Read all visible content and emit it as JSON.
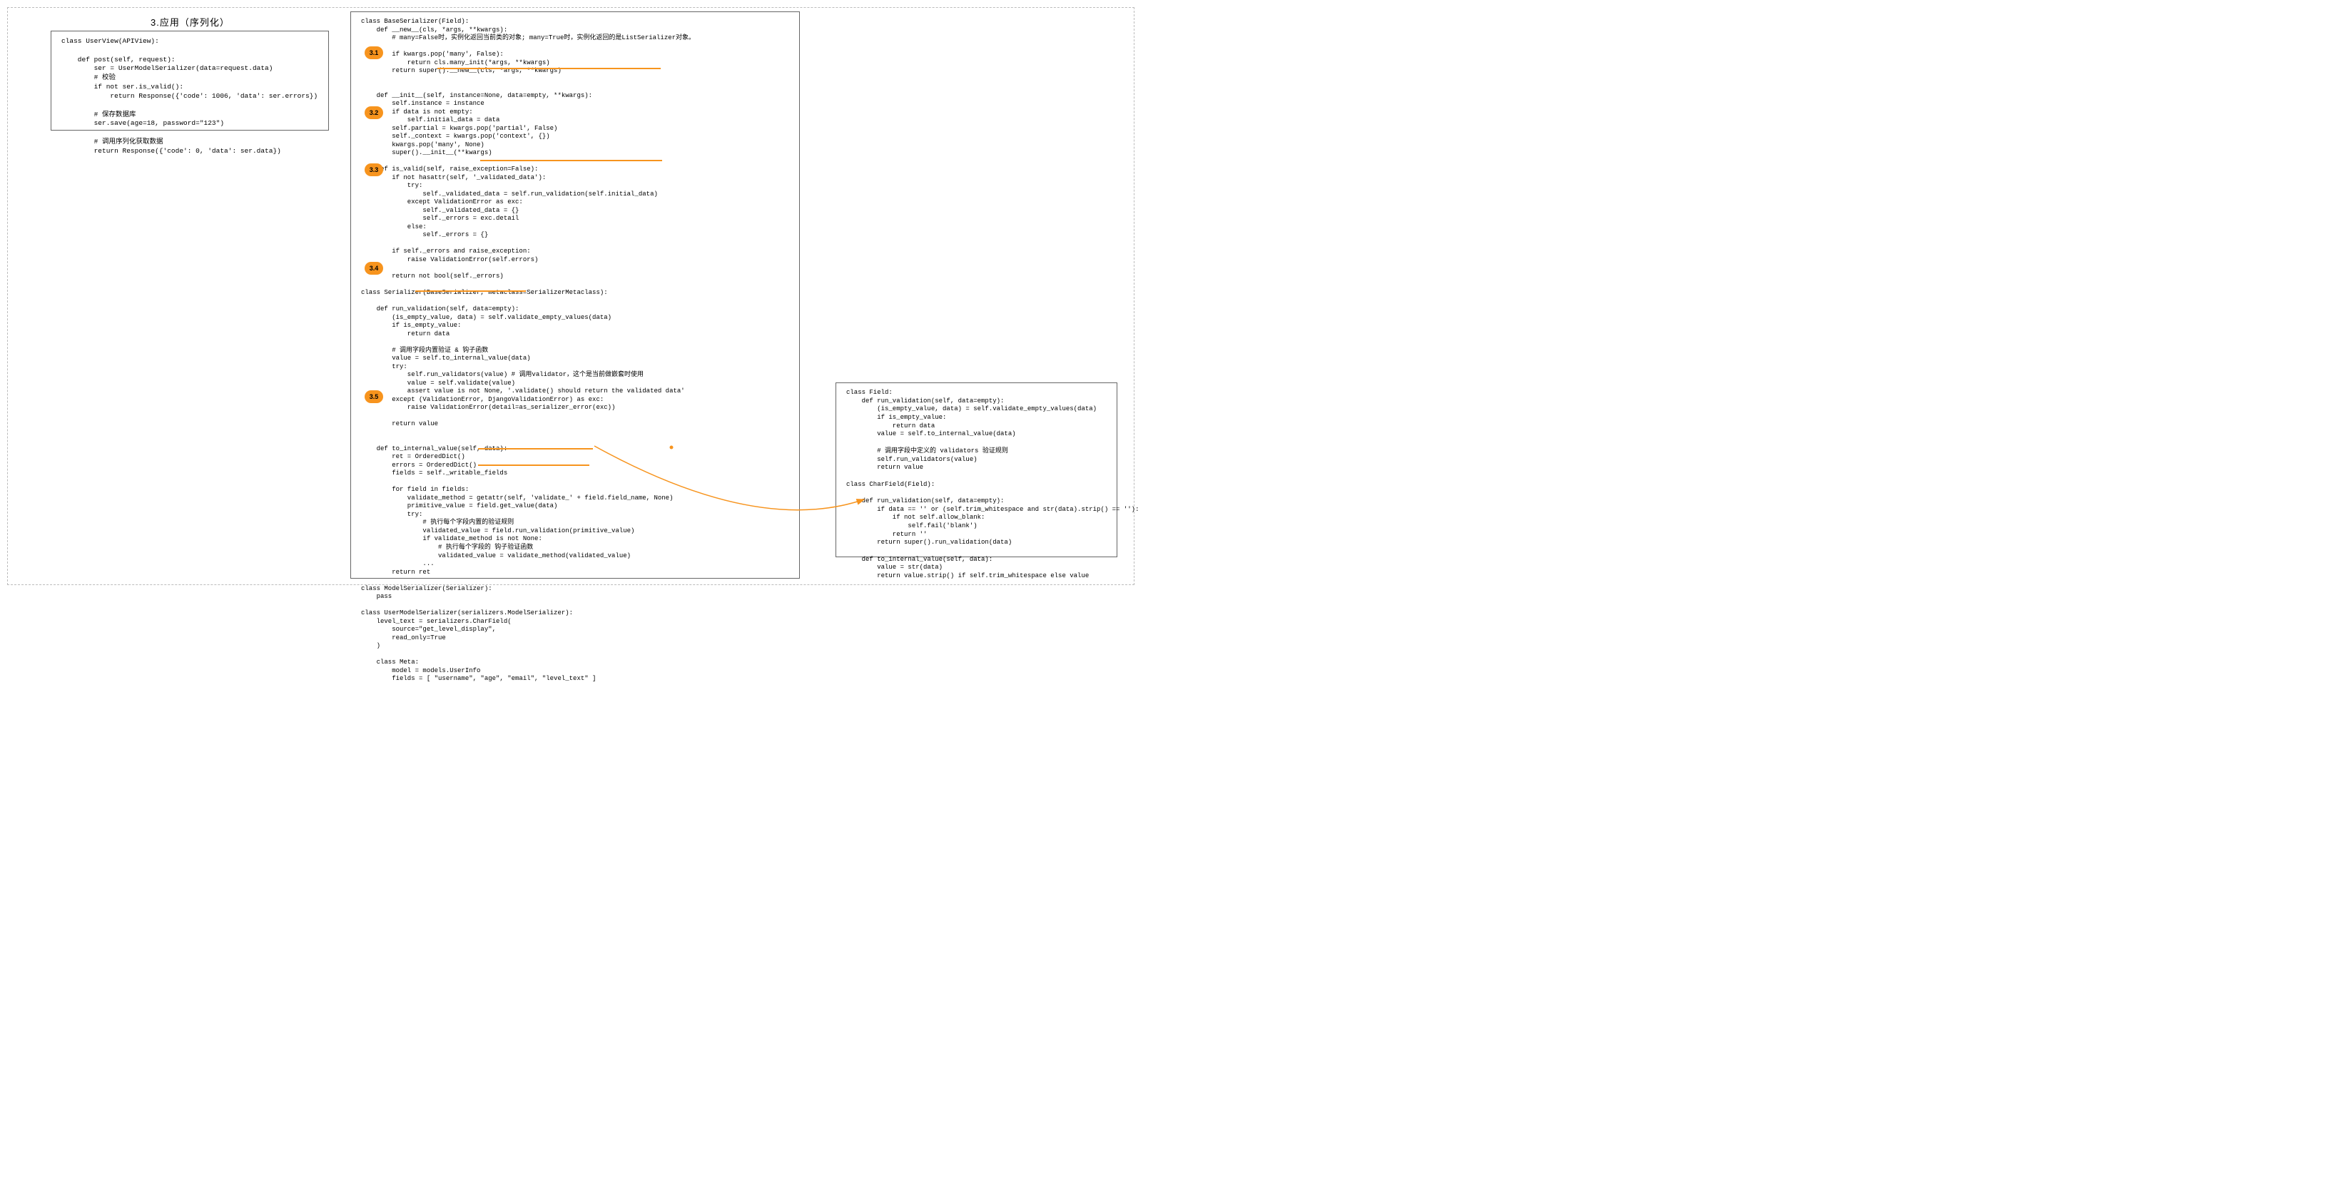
{
  "title": "3.应用（序列化）",
  "badges": {
    "b1": "3.1",
    "b2": "3.2",
    "b3": "3.3",
    "b4": "3.4",
    "b5": "3.5"
  },
  "left_code": "class UserView(APIView):\n\n    def post(self, request):\n        ser = UserModelSerializer(data=request.data)\n        # 校验\n        if not ser.is_valid():\n            return Response({'code': 1006, 'data': ser.errors})\n\n        # 保存数据库\n        ser.save(age=18, password=\"123\")\n\n        # 调用序列化获取数据\n        return Response({'code': 0, 'data': ser.data})",
  "middle_code": "class BaseSerializer(Field):\n    def __new__(cls, *args, **kwargs):\n        # many=False时，实例化返回当前类的对象; many=True时，实例化返回的是ListSerializer对象。\n\n        if kwargs.pop('many', False):\n            return cls.many_init(*args, **kwargs)\n        return super().__new__(cls, *args, **kwargs)\n\n\n    def __init__(self, instance=None, data=empty, **kwargs):\n        self.instance = instance\n        if data is not empty:\n            self.initial_data = data\n        self.partial = kwargs.pop('partial', False)\n        self._context = kwargs.pop('context', {})\n        kwargs.pop('many', None)\n        super().__init__(**kwargs)\n\n    def is_valid(self, raise_exception=False):\n        if not hasattr(self, '_validated_data'):\n            try:\n                self._validated_data = self.run_validation(self.initial_data)\n            except ValidationError as exc:\n                self._validated_data = {}\n                self._errors = exc.detail\n            else:\n                self._errors = {}\n\n        if self._errors and raise_exception:\n            raise ValidationError(self.errors)\n\n        return not bool(self._errors)\n\nclass Serializer(BaseSerializer, metaclass=SerializerMetaclass):\n\n    def run_validation(self, data=empty):\n        (is_empty_value, data) = self.validate_empty_values(data)\n        if is_empty_value:\n            return data\n\n        # 调用字段内置验证 & 钩子函数\n        value = self.to_internal_value(data)\n        try:\n            self.run_validators(value) # 调用validator，这个是当前做嵌套时使用\n            value = self.validate(value)\n            assert value is not None, '.validate() should return the validated data'\n        except (ValidationError, DjangoValidationError) as exc:\n            raise ValidationError(detail=as_serializer_error(exc))\n\n        return value\n\n\n    def to_internal_value(self, data):\n        ret = OrderedDict()\n        errors = OrderedDict()\n        fields = self._writable_fields\n\n        for field in fields:\n            validate_method = getattr(self, 'validate_' + field.field_name, None)\n            primitive_value = field.get_value(data)\n            try:\n                # 执行每个字段内置的验证规则\n                validated_value = field.run_validation(primitive_value)\n                if validate_method is not None:\n                    # 执行每个字段的 钩子验证函数\n                    validated_value = validate_method(validated_value)\n                ...\n        return ret\n\nclass ModelSerializer(Serializer):\n    pass\n\nclass UserModelSerializer(serializers.ModelSerializer):\n    level_text = serializers.CharField(\n        source=\"get_level_display\",\n        read_only=True\n    )\n\n    class Meta:\n        model = models.UserInfo\n        fields = [ \"username\", \"age\", \"email\", \"level_text\" ]",
  "right_code": "class Field:\n    def run_validation(self, data=empty):\n        (is_empty_value, data) = self.validate_empty_values(data)\n        if is_empty_value:\n            return data\n        value = self.to_internal_value(data)\n\n        # 调用字段中定义的 validators 验证规则\n        self.run_validators(value)\n        return value\n\nclass CharField(Field):\n\n    def run_validation(self, data=empty):\n        if data == '' or (self.trim_whitespace and str(data).strip() == ''):\n            if not self.allow_blank:\n                self.fail('blank')\n            return ''\n        return super().run_validation(data)\n\n    def to_internal_value(self, data):\n        value = str(data)\n        return value.strip() if self.trim_whitespace else value"
}
